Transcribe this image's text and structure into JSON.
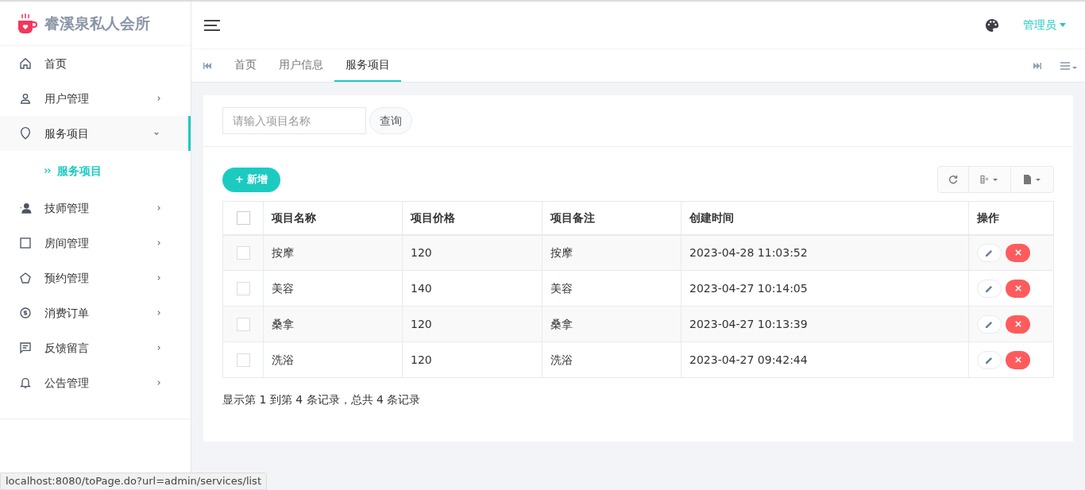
{
  "brand": {
    "title": "睿溪泉私人会所"
  },
  "sidebar": {
    "items": [
      {
        "label": "首页",
        "kind": "link",
        "selected": false
      },
      {
        "label": "用户管理",
        "kind": "menu",
        "selected": false,
        "expanded": false
      },
      {
        "label": "服务项目",
        "kind": "menu",
        "selected": true,
        "expanded": true,
        "children": [
          {
            "label": "服务项目",
            "selected": true
          }
        ]
      },
      {
        "label": "技师管理",
        "kind": "menu",
        "selected": false,
        "expanded": false
      },
      {
        "label": "房间管理",
        "kind": "menu",
        "selected": false,
        "expanded": false
      },
      {
        "label": "预约管理",
        "kind": "menu",
        "selected": false,
        "expanded": false
      },
      {
        "label": "消费订单",
        "kind": "menu",
        "selected": false,
        "expanded": false
      },
      {
        "label": "反馈留言",
        "kind": "menu",
        "selected": false,
        "expanded": false
      },
      {
        "label": "公告管理",
        "kind": "menu",
        "selected": false,
        "expanded": false
      }
    ]
  },
  "header": {
    "user": "管理员"
  },
  "tabs": [
    {
      "label": "首页",
      "selected": false
    },
    {
      "label": "用户信息",
      "selected": false
    },
    {
      "label": "服务项目",
      "selected": true
    }
  ],
  "search": {
    "placeholder": "请输入项目名称",
    "button": "查询"
  },
  "toolbar": {
    "add": "+ 新增"
  },
  "table": {
    "select_all": {
      "checked": false
    },
    "columns": [
      "项目名称",
      "项目价格",
      "项目备注",
      "创建时间",
      "操作"
    ],
    "rows": [
      {
        "checked": false,
        "cells": [
          "按摩",
          "120",
          "按摩",
          "2023-04-28 11:03:52"
        ]
      },
      {
        "checked": false,
        "cells": [
          "美容",
          "140",
          "美容",
          "2023-04-27 10:14:05"
        ]
      },
      {
        "checked": false,
        "cells": [
          "桑拿",
          "120",
          "桑拿",
          "2023-04-27 10:13:39"
        ]
      },
      {
        "checked": false,
        "cells": [
          "洗浴",
          "120",
          "洗浴",
          "2023-04-27 09:42:44"
        ]
      }
    ]
  },
  "pagination": {
    "summary": "显示第 1 到第 4 条记录，总共 4 条记录"
  },
  "status_bar": {
    "url": "localhost:8080/toPage.do?url=admin/services/list"
  }
}
